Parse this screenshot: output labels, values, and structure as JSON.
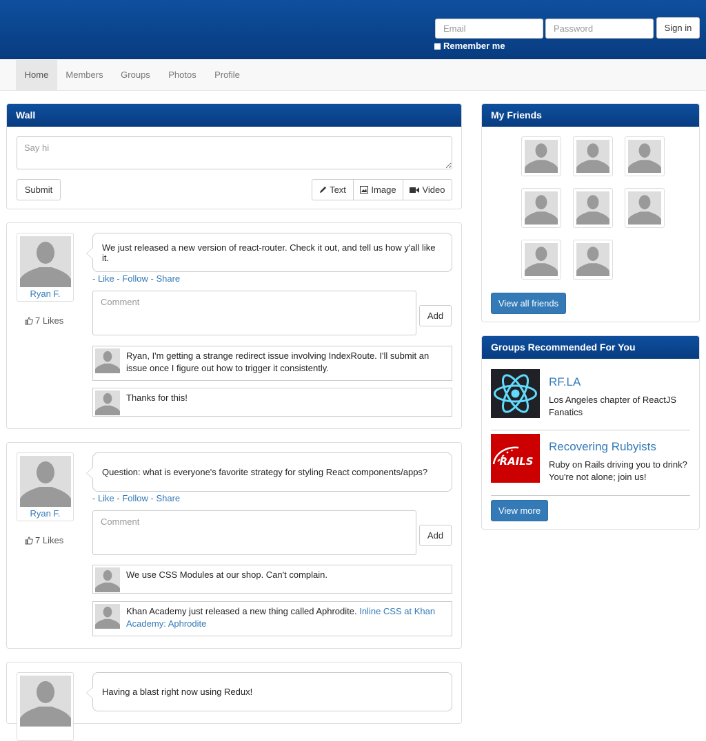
{
  "header": {
    "email_placeholder": "Email",
    "password_placeholder": "Password",
    "signin_label": "Sign in",
    "remember_label": "Remember me"
  },
  "nav": {
    "items": [
      {
        "label": "Home",
        "active": true
      },
      {
        "label": "Members",
        "active": false
      },
      {
        "label": "Groups",
        "active": false
      },
      {
        "label": "Photos",
        "active": false
      },
      {
        "label": "Profile",
        "active": false
      }
    ]
  },
  "wall": {
    "title": "Wall",
    "input_placeholder": "Say hi",
    "submit_label": "Submit",
    "type_buttons": [
      {
        "label": "Text",
        "icon": "pencil-icon"
      },
      {
        "label": "Image",
        "icon": "image-icon"
      },
      {
        "label": "Video",
        "icon": "video-icon"
      }
    ]
  },
  "posts": [
    {
      "author": "Ryan F.",
      "likes": "7 Likes",
      "text": "We just released a new version of react-router. Check it out, and tell us how y'all like it.",
      "actions": "- Like - Follow - Share",
      "comment_placeholder": "Comment",
      "add_label": "Add",
      "replies": [
        {
          "text": "Ryan, I'm getting a strange redirect issue involving IndexRoute. I'll submit an issue once I figure out how to trigger it consistently."
        },
        {
          "text": "Thanks for this!"
        }
      ]
    },
    {
      "author": "Ryan F.",
      "likes": "7 Likes",
      "text": "Question: what is everyone's favorite strategy for styling React components/apps?",
      "actions": "- Like - Follow - Share",
      "comment_placeholder": "Comment",
      "add_label": "Add",
      "replies": [
        {
          "text": "We use CSS Modules at our shop. Can't complain."
        },
        {
          "text": "Khan Academy just released a new thing called Aphrodite. ",
          "link": "Inline CSS at Khan Academy: Aphrodite"
        }
      ]
    },
    {
      "text": "Having a blast right now using Redux!"
    }
  ],
  "friends": {
    "title": "My Friends",
    "count": 8,
    "view_all_label": "View all friends"
  },
  "groups": {
    "title": "Groups Recommended For You",
    "items": [
      {
        "name": "RF.LA",
        "description": "Los Angeles chapter of ReactJS Fanatics",
        "logo": "react-logo-icon"
      },
      {
        "name": "Recovering Rubyists",
        "description": "Ruby on Rails driving you to drink? You're not alone; join us!",
        "logo": "rails-logo-icon",
        "logo_text": "RAILS"
      }
    ],
    "view_more_label": "View more"
  },
  "colors": {
    "header_blue": "#0e4f9e",
    "link_blue": "#337ab7",
    "rails_red": "#cc0000",
    "react_cyan": "#61dafb"
  }
}
